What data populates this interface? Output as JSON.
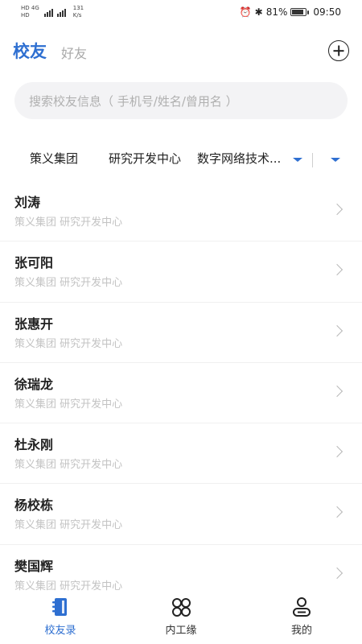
{
  "status_bar": {
    "left_top": "HD 4G",
    "left_bottom": "HD",
    "speed_value": "131",
    "speed_unit": "K/s",
    "battery": "81%",
    "time": "09:50"
  },
  "header": {
    "active_tab": "校友",
    "inactive_tab": "好友"
  },
  "search": {
    "placeholder": "搜索校友信息（ 手机号/姓名/曾用名 ）"
  },
  "filters": [
    {
      "label": "策义集团"
    },
    {
      "label": "研究开发中心"
    },
    {
      "label": "数字网络技术..."
    }
  ],
  "contacts": [
    {
      "name": "刘涛",
      "org": "策义集团 研究开发中心"
    },
    {
      "name": "张可阳",
      "org": "策义集团 研究开发中心"
    },
    {
      "name": "张惠开",
      "org": "策义集团 研究开发中心"
    },
    {
      "name": "徐瑞龙",
      "org": "策义集团 研究开发中心"
    },
    {
      "name": "杜永刚",
      "org": "策义集团 研究开发中心"
    },
    {
      "name": "杨校栋",
      "org": "策义集团 研究开发中心"
    },
    {
      "name": "樊国辉",
      "org": "策义集团 研究开发中心"
    }
  ],
  "bottom_nav": [
    {
      "label": "校友录",
      "icon": "contact-book-icon",
      "active": true
    },
    {
      "label": "内工缘",
      "icon": "apps-grid-icon",
      "active": false
    },
    {
      "label": "我的",
      "icon": "user-profile-icon",
      "active": false
    }
  ],
  "colors": {
    "accent": "#2e6fd1",
    "muted_text": "#c3c3c3"
  }
}
